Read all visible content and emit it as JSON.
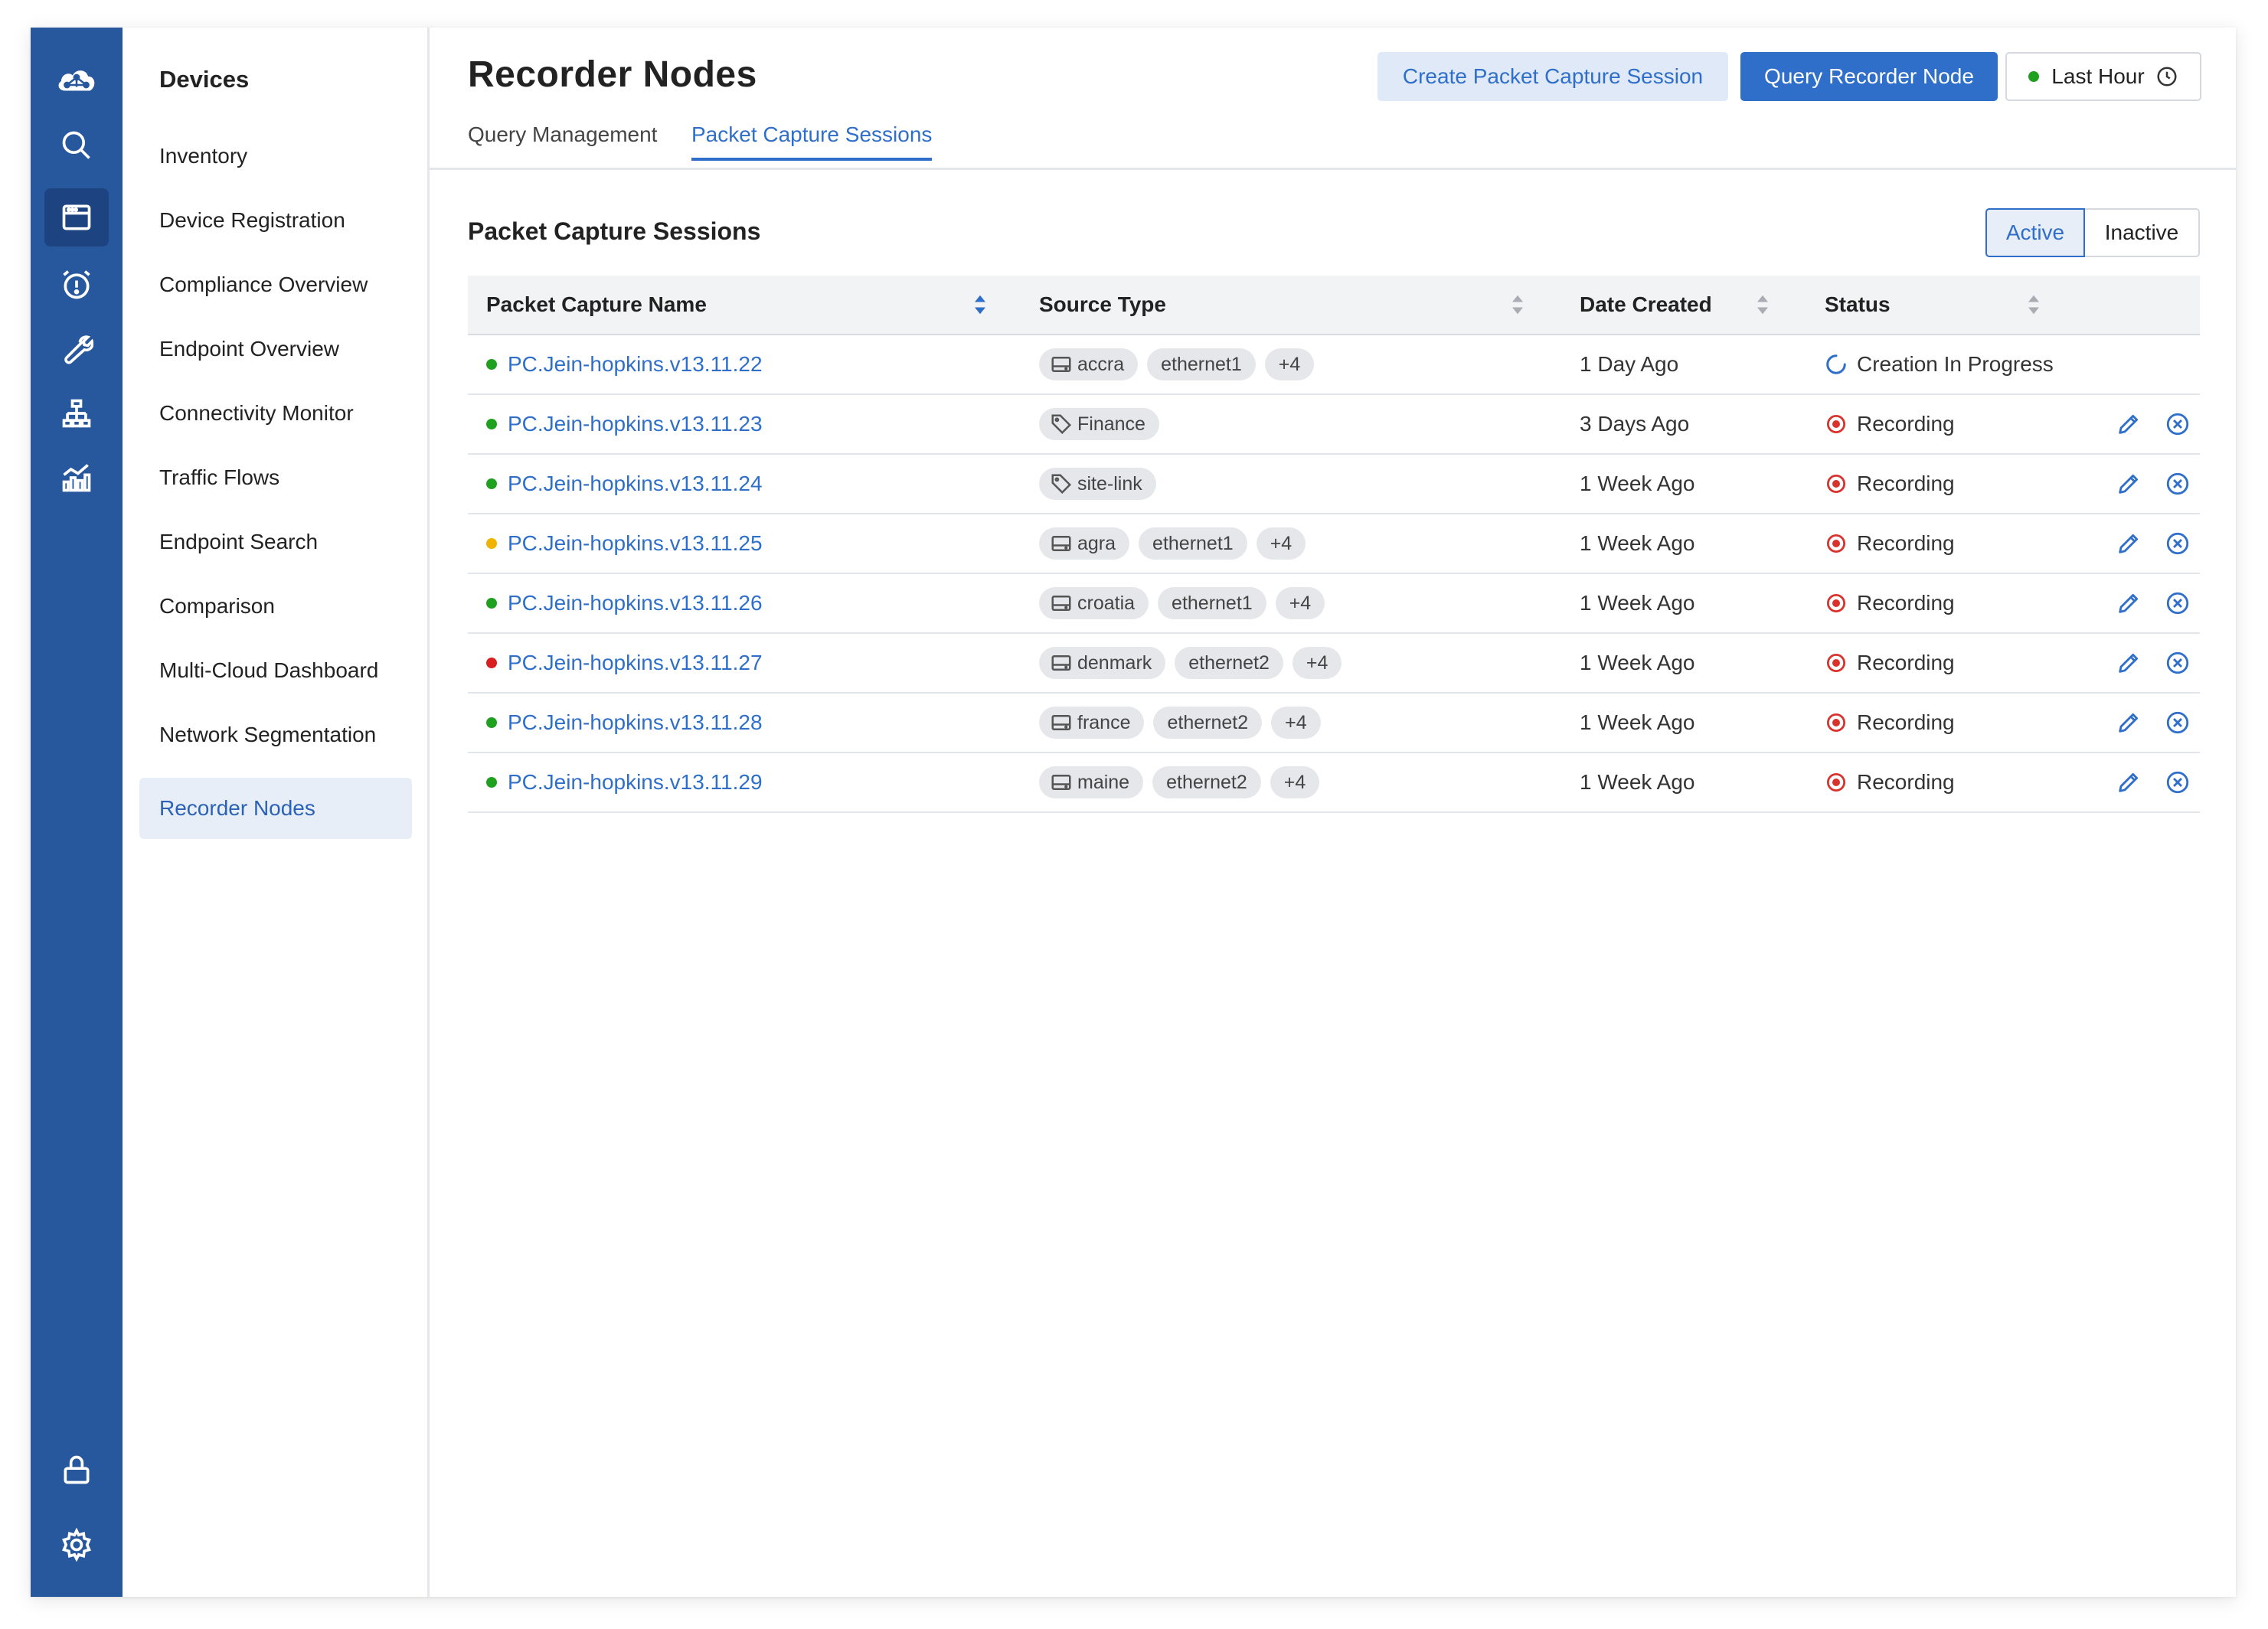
{
  "sidebar_icons": [
    {
      "name": "cloud-logo-icon"
    },
    {
      "name": "search-icon"
    },
    {
      "name": "devices-icon",
      "active": true
    },
    {
      "name": "alarm-icon"
    },
    {
      "name": "wrench-icon"
    },
    {
      "name": "network-topology-icon"
    },
    {
      "name": "analytics-icon"
    },
    {
      "name": "lock-icon"
    },
    {
      "name": "gear-icon"
    }
  ],
  "nav": {
    "title": "Devices",
    "items": [
      {
        "label": "Inventory"
      },
      {
        "label": "Device Registration"
      },
      {
        "label": "Compliance Overview"
      },
      {
        "label": "Endpoint Overview"
      },
      {
        "label": "Connectivity Monitor"
      },
      {
        "label": "Traffic Flows"
      },
      {
        "label": "Endpoint Search"
      },
      {
        "label": "Comparison"
      },
      {
        "label": "Multi-Cloud Dashboard"
      },
      {
        "label": "Network Segmentation"
      },
      {
        "label": "Recorder Nodes",
        "active": true
      }
    ]
  },
  "header": {
    "title": "Recorder Nodes",
    "tabs": [
      {
        "label": "Query Management"
      },
      {
        "label": "Packet Capture Sessions",
        "active": true
      }
    ],
    "create_button": "Create Packet Capture Session",
    "query_button": "Query Recorder Node",
    "time_range": "Last Hour"
  },
  "section": {
    "title": "Packet Capture Sessions",
    "toggle": {
      "active": "Active",
      "inactive": "Inactive"
    }
  },
  "table": {
    "columns": [
      "Packet Capture Name",
      "Source Type",
      "Date Created",
      "Status"
    ],
    "rows": [
      {
        "name": "PC.Jein-hopkins.v13.11.22",
        "health": "green",
        "chips": [
          {
            "icon": "device",
            "label": "accra"
          },
          {
            "label": "ethernet1"
          },
          {
            "label": "+4"
          }
        ],
        "date": "1 Day Ago",
        "status": "Creation In Progress",
        "status_kind": "progress"
      },
      {
        "name": "PC.Jein-hopkins.v13.11.23",
        "health": "green",
        "chips": [
          {
            "icon": "tag",
            "label": "Finance"
          }
        ],
        "date": "3 Days Ago",
        "status": "Recording",
        "status_kind": "recording"
      },
      {
        "name": "PC.Jein-hopkins.v13.11.24",
        "health": "green",
        "chips": [
          {
            "icon": "tag",
            "label": "site-link"
          }
        ],
        "date": "1 Week Ago",
        "status": "Recording",
        "status_kind": "recording"
      },
      {
        "name": "PC.Jein-hopkins.v13.11.25",
        "health": "yellow",
        "chips": [
          {
            "icon": "device",
            "label": "agra"
          },
          {
            "label": "ethernet1"
          },
          {
            "label": "+4"
          }
        ],
        "date": "1 Week Ago",
        "status": "Recording",
        "status_kind": "recording"
      },
      {
        "name": "PC.Jein-hopkins.v13.11.26",
        "health": "green",
        "chips": [
          {
            "icon": "device",
            "label": "croatia"
          },
          {
            "label": "ethernet1"
          },
          {
            "label": "+4"
          }
        ],
        "date": "1 Week Ago",
        "status": "Recording",
        "status_kind": "recording"
      },
      {
        "name": "PC.Jein-hopkins.v13.11.27",
        "health": "red",
        "chips": [
          {
            "icon": "device",
            "label": "denmark"
          },
          {
            "label": "ethernet2"
          },
          {
            "label": "+4"
          }
        ],
        "date": "1 Week Ago",
        "status": "Recording",
        "status_kind": "recording"
      },
      {
        "name": "PC.Jein-hopkins.v13.11.28",
        "health": "green",
        "chips": [
          {
            "icon": "device",
            "label": "france"
          },
          {
            "label": "ethernet2"
          },
          {
            "label": "+4"
          }
        ],
        "date": "1 Week Ago",
        "status": "Recording",
        "status_kind": "recording"
      },
      {
        "name": "PC.Jein-hopkins.v13.11.29",
        "health": "green",
        "chips": [
          {
            "icon": "device",
            "label": "maine"
          },
          {
            "label": "ethernet2"
          },
          {
            "label": "+4"
          }
        ],
        "date": "1 Week Ago",
        "status": "Recording",
        "status_kind": "recording"
      }
    ]
  },
  "colors": {
    "rail": "#27579c",
    "accent": "#2f6fc9",
    "health_green": "#1fa01f",
    "health_yellow": "#f0b400",
    "health_red": "#d81e1e",
    "recording_red": "#d9312b"
  }
}
